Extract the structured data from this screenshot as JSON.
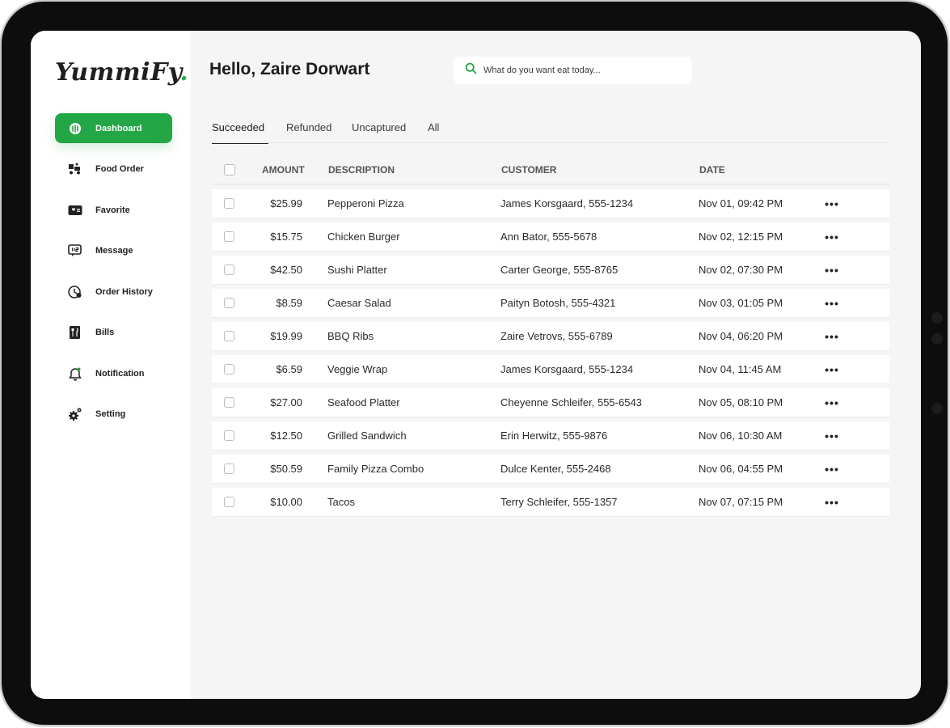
{
  "app": {
    "logo_text": "YummiFy",
    "logo_dot": ".",
    "greeting": "Hello, Zaire Dorwart",
    "accent_color": "#23a645"
  },
  "search": {
    "placeholder": "What do you want eat today..."
  },
  "sidebar": {
    "items": [
      {
        "label": "Dashboard",
        "icon": "dashboard-icon",
        "active": true
      },
      {
        "label": "Food Order",
        "icon": "delivery-icon"
      },
      {
        "label": "Favorite",
        "icon": "favorite-card-icon"
      },
      {
        "label": "Message",
        "icon": "message-icon"
      },
      {
        "label": "Order History",
        "icon": "order-history-icon"
      },
      {
        "label": "Bills",
        "icon": "bills-icon"
      },
      {
        "label": "Notification",
        "icon": "bell-icon"
      },
      {
        "label": "Setting",
        "icon": "gear-icon"
      }
    ]
  },
  "tabs": [
    {
      "label": "Succeeded",
      "active": true
    },
    {
      "label": "Refunded"
    },
    {
      "label": "Uncaptured"
    },
    {
      "label": "All"
    }
  ],
  "table": {
    "headers": {
      "amount": "AMOUNT",
      "description": "DESCRIPTION",
      "customer": "CUSTOMER",
      "date": "DATE"
    },
    "more_label": "•••",
    "rows": [
      {
        "amount": "$25.99",
        "description": "Pepperoni Pizza",
        "customer": "James Korsgaard, 555-1234",
        "date": "Nov 01, 09:42 PM"
      },
      {
        "amount": "$15.75",
        "description": "Chicken Burger",
        "customer": "Ann Bator, 555-5678",
        "date": "Nov 02, 12:15 PM"
      },
      {
        "amount": "$42.50",
        "description": "Sushi Platter",
        "customer": "Carter George, 555-8765",
        "date": "Nov 02, 07:30 PM"
      },
      {
        "amount": "$8.59",
        "description": "Caesar Salad",
        "customer": "Paityn Botosh, 555-4321",
        "date": "Nov 03, 01:05 PM"
      },
      {
        "amount": "$19.99",
        "description": "BBQ Ribs",
        "customer": "Zaire Vetrovs, 555-6789",
        "date": "Nov 04, 06:20 PM"
      },
      {
        "amount": "$6.59",
        "description": "Veggie Wrap",
        "customer": "James Korsgaard, 555-1234",
        "date": "Nov 04, 11:45 AM"
      },
      {
        "amount": "$27.00",
        "description": "Seafood Platter",
        "customer": "Cheyenne Schleifer, 555-6543",
        "date": "Nov 05, 08:10 PM"
      },
      {
        "amount": "$12.50",
        "description": "Grilled Sandwich",
        "customer": "Erin Herwitz, 555-9876",
        "date": "Nov 06, 10:30 AM"
      },
      {
        "amount": "$50.59",
        "description": "Family Pizza Combo",
        "customer": "Dulce Kenter, 555-2468",
        "date": "Nov 06, 04:55 PM"
      },
      {
        "amount": "$10.00",
        "description": "Tacos",
        "customer": "Terry Schleifer, 555-1357",
        "date": "Nov 07, 07:15 PM"
      }
    ]
  }
}
